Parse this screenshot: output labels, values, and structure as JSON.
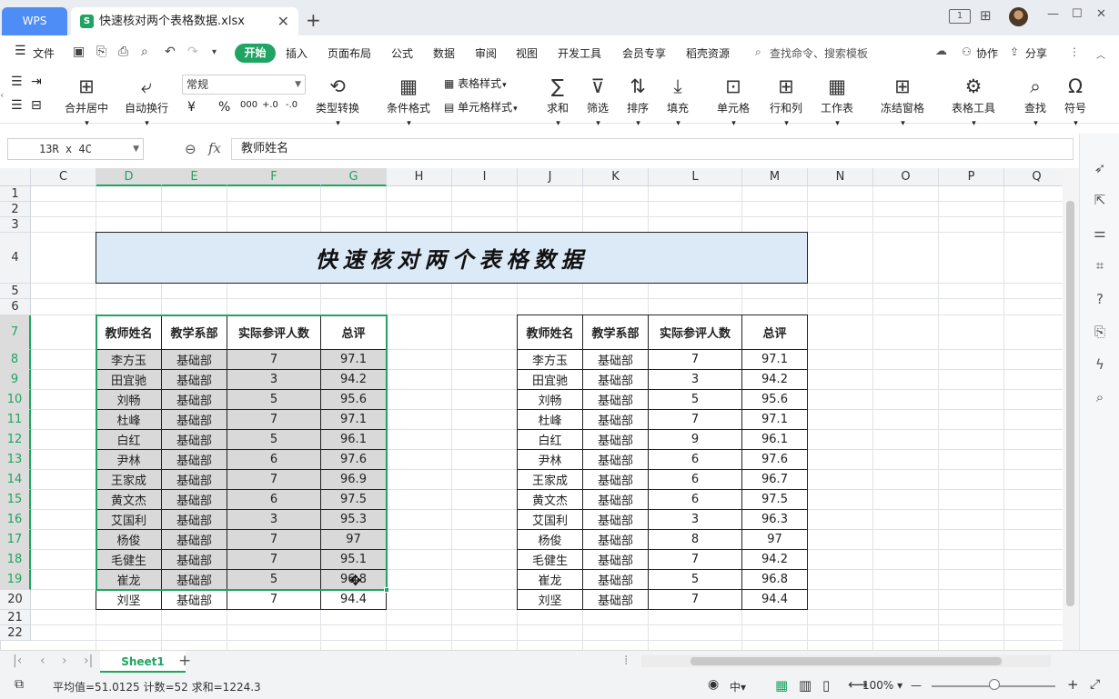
{
  "titlebar": {
    "app_tab": "WPS",
    "file_tab": "快速核对两个表格数据.xlsx",
    "file_icon": "S",
    "close_tab": "✕",
    "new_tab": "+",
    "page_badge": "1",
    "min": "—",
    "max": "☐",
    "close": "✕"
  },
  "menubar": {
    "file": "文件",
    "start": "开始",
    "items": [
      "插入",
      "页面布局",
      "公式",
      "数据",
      "审阅",
      "视图",
      "开发工具",
      "会员专享",
      "稻壳资源"
    ],
    "search_placeholder": "查找命令、搜索模板",
    "collab": "协作",
    "share": "分享"
  },
  "ribbon": {
    "merge_center": "合并居中",
    "auto_wrap": "自动换行",
    "number_format": "常规",
    "currency": "¥",
    "percent": "%",
    "thousands": "000",
    "dec_inc": "+.0",
    "dec_dec": "-.0",
    "type_convert": "类型转换",
    "cond_format": "条件格式",
    "table_style": "表格样式",
    "cell_style": "单元格样式",
    "sum": "求和",
    "filter": "筛选",
    "sort": "排序",
    "fill": "填充",
    "cell": "单元格",
    "row_col": "行和列",
    "worksheet": "工作表",
    "freeze": "冻结窗格",
    "table_tools": "表格工具",
    "find": "查找",
    "symbol": "符号"
  },
  "formula_bar": {
    "name_box": "13R x 4C",
    "fx": "fx",
    "content": "教师姓名"
  },
  "grid": {
    "columns": [
      "C",
      "D",
      "E",
      "F",
      "G",
      "H",
      "I",
      "J",
      "K",
      "L",
      "M",
      "N",
      "O",
      "P",
      "Q"
    ],
    "rows": [
      "1",
      "2",
      "3",
      "4",
      "5",
      "6",
      "7",
      "8",
      "9",
      "10",
      "11",
      "12",
      "13",
      "14",
      "15",
      "16",
      "17",
      "18",
      "19",
      "20",
      "21",
      "22"
    ],
    "title": "快速核对两个表格数据",
    "headers": [
      "教师姓名",
      "教学系部",
      "实际参评人数",
      "总评"
    ],
    "left_table": [
      [
        "李方玉",
        "基础部",
        "7",
        "97.1"
      ],
      [
        "田宜驰",
        "基础部",
        "3",
        "94.2"
      ],
      [
        "刘畅",
        "基础部",
        "5",
        "95.6"
      ],
      [
        "杜峰",
        "基础部",
        "7",
        "97.1"
      ],
      [
        "白红",
        "基础部",
        "5",
        "96.1"
      ],
      [
        "尹林",
        "基础部",
        "6",
        "97.6"
      ],
      [
        "王家成",
        "基础部",
        "7",
        "96.9"
      ],
      [
        "黄文杰",
        "基础部",
        "6",
        "97.5"
      ],
      [
        "艾国利",
        "基础部",
        "3",
        "95.3"
      ],
      [
        "杨俊",
        "基础部",
        "7",
        "97"
      ],
      [
        "毛健生",
        "基础部",
        "7",
        "95.1"
      ],
      [
        "崔龙",
        "基础部",
        "5",
        "96.8"
      ],
      [
        "刘坚",
        "基础部",
        "7",
        "94.4"
      ]
    ],
    "right_table": [
      [
        "李方玉",
        "基础部",
        "7",
        "97.1"
      ],
      [
        "田宜驰",
        "基础部",
        "3",
        "94.2"
      ],
      [
        "刘畅",
        "基础部",
        "5",
        "95.6"
      ],
      [
        "杜峰",
        "基础部",
        "7",
        "97.1"
      ],
      [
        "白红",
        "基础部",
        "9",
        "96.1"
      ],
      [
        "尹林",
        "基础部",
        "6",
        "97.6"
      ],
      [
        "王家成",
        "基础部",
        "6",
        "96.7"
      ],
      [
        "黄文杰",
        "基础部",
        "6",
        "97.5"
      ],
      [
        "艾国利",
        "基础部",
        "3",
        "96.3"
      ],
      [
        "杨俊",
        "基础部",
        "8",
        "97"
      ],
      [
        "毛健生",
        "基础部",
        "7",
        "94.2"
      ],
      [
        "崔龙",
        "基础部",
        "5",
        "96.8"
      ],
      [
        "刘坚",
        "基础部",
        "7",
        "94.4"
      ]
    ]
  },
  "sheetbar": {
    "sheet_name": "Sheet1",
    "add": "+"
  },
  "statusbar": {
    "summary": "平均值=51.0125  计数=52  求和=1224.3",
    "zoom": "100%",
    "zoom_out": "—",
    "zoom_in": "+"
  },
  "colors": {
    "accent": "#1fa463",
    "wps_tab": "#4e8df5",
    "title_fill": "#dce9f7",
    "selection_fill": "#d9d9d9"
  }
}
